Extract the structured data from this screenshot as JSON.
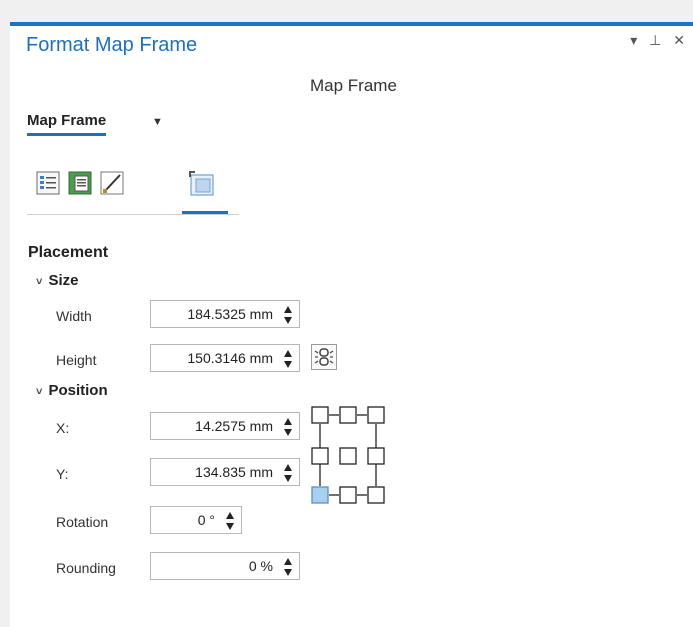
{
  "panel": {
    "title": "Format Map Frame",
    "window_controls": "▾ ⊥ ✕",
    "subtitle": "Map Frame",
    "element_dropdown": "Map Frame"
  },
  "tabs": [
    {
      "name": "options-tab-icon",
      "active": false
    },
    {
      "name": "display-options-tab-icon",
      "active": false
    },
    {
      "name": "symbol-tab-icon",
      "active": false
    },
    {
      "name": "placement-tab-icon",
      "active": true
    }
  ],
  "placement": {
    "heading": "Placement",
    "size": {
      "heading": "Size",
      "width_label": "Width",
      "width_value": "184.5325 mm",
      "height_label": "Height",
      "height_value": "150.3146 mm"
    },
    "position": {
      "heading": "Position",
      "x_label": "X:",
      "x_value": "14.2575 mm",
      "y_label": "Y:",
      "y_value": "134.835 mm",
      "rotation_label": "Rotation",
      "rotation_value": "0 °",
      "rounding_label": "Rounding",
      "rounding_value": "0 %"
    },
    "anchor_selected": "bottom-left"
  },
  "colors": {
    "accent": "#1f6fc1",
    "anchor_selected_fill": "#a9cfee"
  }
}
